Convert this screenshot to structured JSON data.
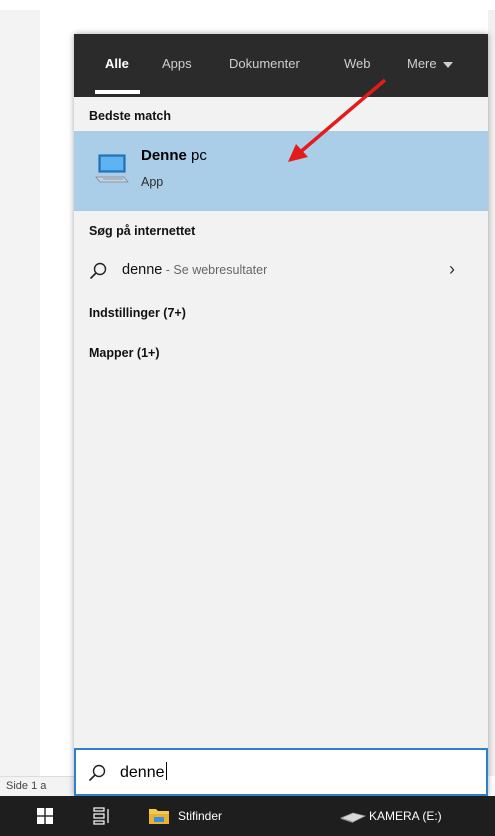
{
  "background": {
    "status_text": "Side 1 a"
  },
  "search_panel": {
    "tabs": [
      {
        "label": "Alle",
        "active": true
      },
      {
        "label": "Apps",
        "active": false
      },
      {
        "label": "Dokumenter",
        "active": false
      },
      {
        "label": "Web",
        "active": false
      },
      {
        "label": "Mere",
        "active": false
      }
    ],
    "best_match": {
      "heading": "Bedste match",
      "title_bold": "Denne",
      "title_rest": " pc",
      "subtitle": "App",
      "icon": "computer-icon"
    },
    "web": {
      "heading": "Søg på internettet",
      "query": "denne",
      "hint": " - Se webresultater",
      "icon": "search-icon"
    },
    "settings": {
      "label": "Indstillinger (7+)"
    },
    "folders": {
      "label": "Mapper (1+)"
    }
  },
  "search_box": {
    "value": "denne",
    "icon": "search-icon"
  },
  "taskbar": {
    "items": [
      {
        "icon": "windows-start-icon"
      },
      {
        "icon": "task-view-icon"
      },
      {
        "label": "Stifinder",
        "icon": "file-explorer-icon"
      },
      {
        "label": "KAMERA (E:)",
        "icon": "drive-icon"
      }
    ]
  },
  "colors": {
    "tab_bar": "#2b2b2b",
    "panel_bg": "#f2f2f2",
    "highlight": "#aacde8",
    "search_border": "#2f7fd1",
    "taskbar": "#1e1e1e",
    "annotation_arrow": "#e31b1b"
  }
}
